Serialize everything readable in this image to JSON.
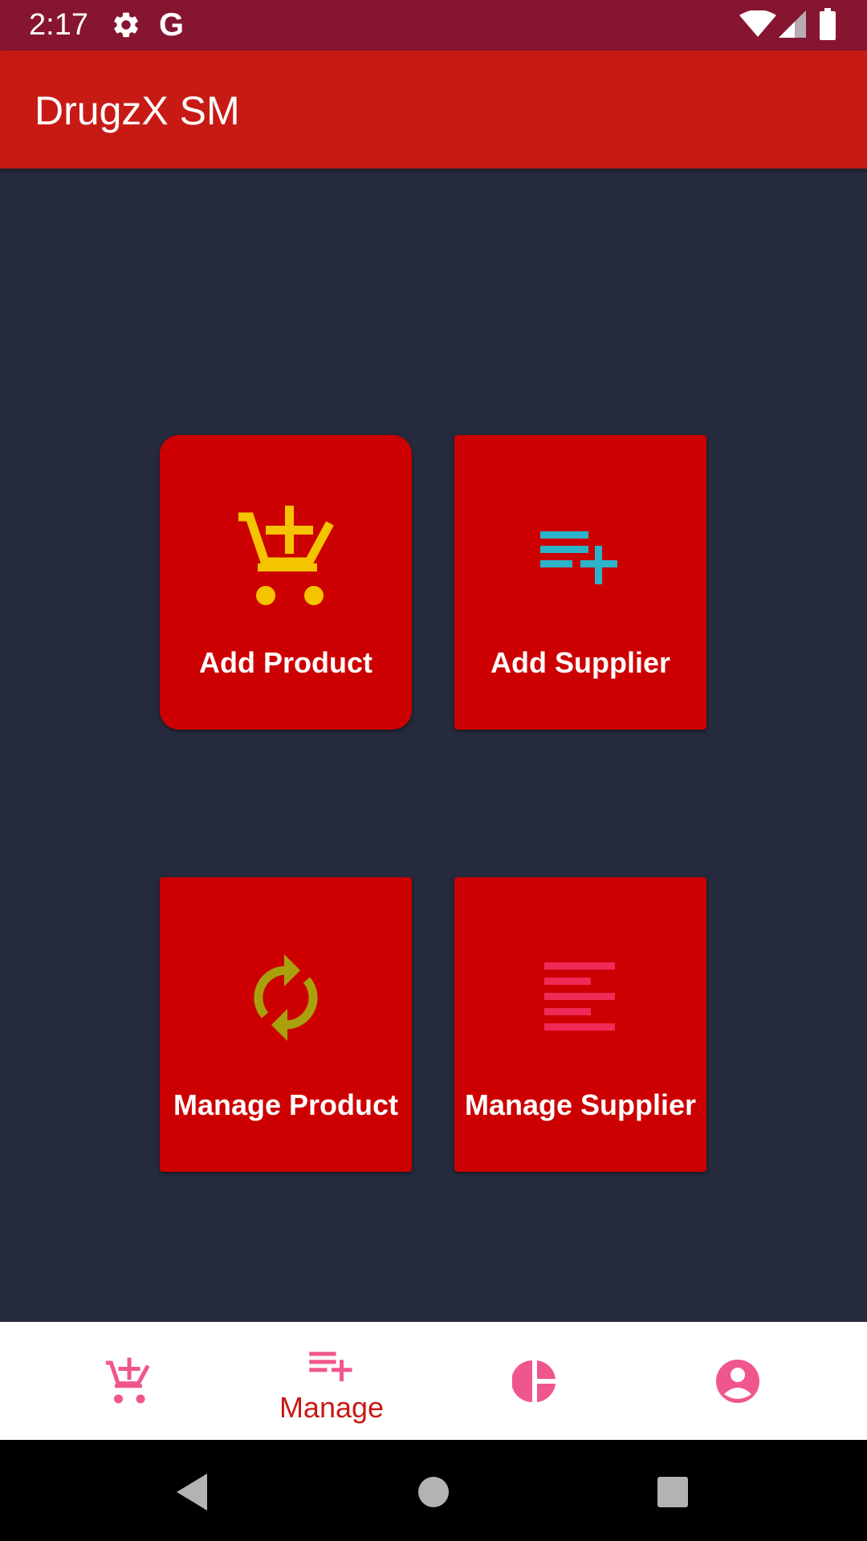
{
  "status_bar": {
    "time": "2:17",
    "icons": [
      "gear-icon",
      "google-g-icon",
      "wifi-icon",
      "cell-signal-icon",
      "battery-icon"
    ]
  },
  "app_bar": {
    "title": "DrugzX SM"
  },
  "tiles": [
    {
      "label": "Add Product",
      "icon": "cart-plus-icon",
      "icon_color": "#f5c400"
    },
    {
      "label": "Add Supplier",
      "icon": "playlist-add-icon",
      "icon_color": "#2bb3c9"
    },
    {
      "label": "Manage Product",
      "icon": "sync-icon",
      "icon_color": "#a9a00e"
    },
    {
      "label": "Manage Supplier",
      "icon": "sort-lines-icon",
      "icon_color": "#ef2a57"
    }
  ],
  "bottom_nav": {
    "items": [
      {
        "label": "",
        "icon": "cart-plus-icon"
      },
      {
        "label": "Manage",
        "icon": "playlist-add-icon",
        "active": true
      },
      {
        "label": "",
        "icon": "pie-chart-icon"
      },
      {
        "label": "",
        "icon": "account-circle-icon"
      }
    ],
    "active_color": "#c81a15",
    "inactive_color": "#f0568e"
  },
  "colors": {
    "status_bar": "#861531",
    "app_bar": "#c81a15",
    "background": "#252a3c",
    "tile": "#cc0001"
  }
}
